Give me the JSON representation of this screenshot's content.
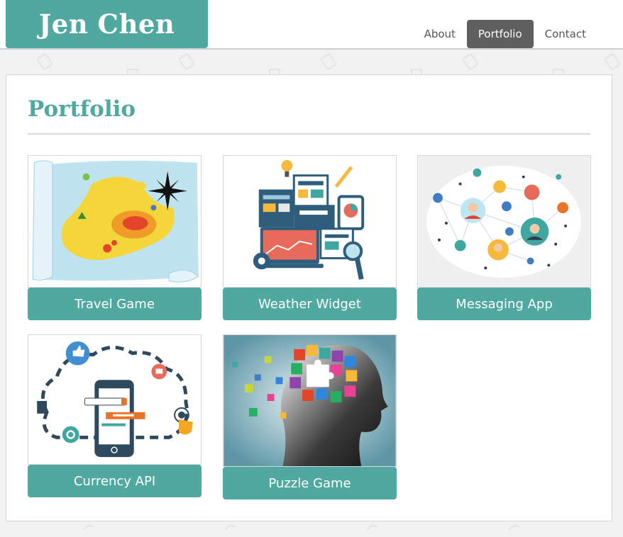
{
  "header": {
    "brand": "Jen Chen",
    "nav": [
      {
        "label": "About",
        "active": false
      },
      {
        "label": "Portfolio",
        "active": true
      },
      {
        "label": "Contact",
        "active": false
      }
    ]
  },
  "main": {
    "title": "Portfolio",
    "projects": [
      {
        "label": "Travel Game",
        "image": "treasure-map-illustration"
      },
      {
        "label": "Weather Widget",
        "image": "dashboard-devices-illustration"
      },
      {
        "label": "Messaging App",
        "image": "social-network-illustration"
      },
      {
        "label": "Currency API",
        "image": "phone-cloud-illustration"
      },
      {
        "label": "Puzzle Game",
        "image": "puzzle-head-illustration"
      }
    ]
  },
  "colors": {
    "accent": "#4fa9a0",
    "nav_active": "#5f5f5f",
    "page_background": "#f2f2f2"
  }
}
